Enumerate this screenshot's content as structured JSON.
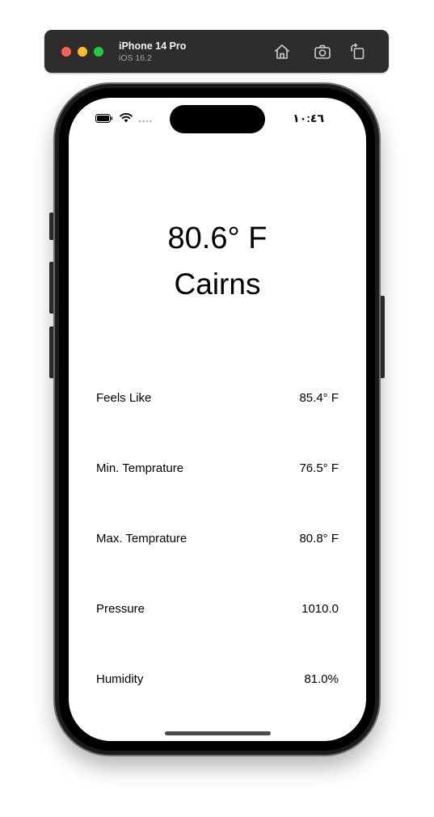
{
  "simulator": {
    "device_name": "iPhone 14 Pro",
    "os_version": "iOS 16.2",
    "toolbar_icons": [
      "home-icon",
      "screenshot-icon",
      "rotate-icon"
    ]
  },
  "status_bar": {
    "time": "١٠:٤٦",
    "icons": [
      "battery-icon",
      "wifi-icon",
      "cellular-signal-icon"
    ]
  },
  "weather": {
    "temperature": "80.6° F",
    "city": "Cairns",
    "stats": [
      {
        "label": "Feels Like",
        "value": "85.4° F"
      },
      {
        "label": "Min. Temprature",
        "value": "76.5° F"
      },
      {
        "label": "Max. Temprature",
        "value": "80.8° F"
      },
      {
        "label": "Pressure",
        "value": "1010.0"
      },
      {
        "label": "Humidity",
        "value": "81.0%"
      }
    ]
  }
}
